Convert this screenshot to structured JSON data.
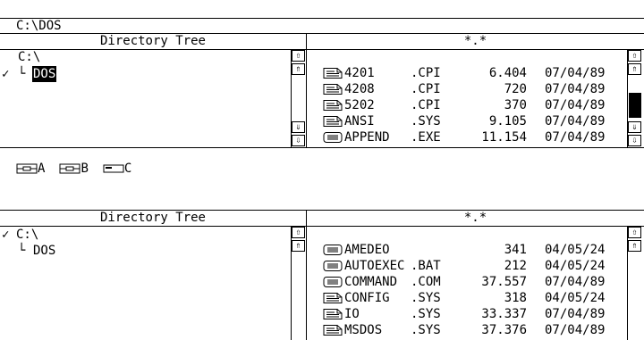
{
  "path": "C:\\DOS",
  "top": {
    "tree_header": "Directory Tree",
    "files_header": "*.*",
    "tree": {
      "root": "C:\\",
      "child_prefix": "└",
      "child": "DOS",
      "check": "✓"
    },
    "files": [
      {
        "icon": "document-icon",
        "name": "4201",
        "ext": ".CPI",
        "size": "6.404",
        "date": "07/04/89"
      },
      {
        "icon": "document-icon",
        "name": "4208",
        "ext": ".CPI",
        "size": "720",
        "date": "07/04/89"
      },
      {
        "icon": "document-icon",
        "name": "5202",
        "ext": ".CPI",
        "size": "370",
        "date": "07/04/89"
      },
      {
        "icon": "document-icon",
        "name": "ANSI",
        "ext": ".SYS",
        "size": "9.105",
        "date": "07/04/89"
      },
      {
        "icon": "program-icon",
        "name": "APPEND",
        "ext": ".EXE",
        "size": "11.154",
        "date": "07/04/89"
      }
    ]
  },
  "drives": [
    "A",
    "B",
    "C"
  ],
  "bottom": {
    "tree_header": "Directory Tree",
    "files_header": "*.*",
    "tree": {
      "root": "C:\\",
      "child_prefix": "└",
      "child": "DOS",
      "check": "✓"
    },
    "files": [
      {
        "icon": "program-icon",
        "name": "AMEDEO",
        "ext": "",
        "size": "341",
        "date": "04/05/24"
      },
      {
        "icon": "program-icon",
        "name": "AUTOEXEC",
        "ext": ".BAT",
        "size": "212",
        "date": "04/05/24"
      },
      {
        "icon": "program-icon",
        "name": "COMMAND",
        "ext": ".COM",
        "size": "37.557",
        "date": "07/04/89"
      },
      {
        "icon": "document-icon",
        "name": "CONFIG",
        "ext": ".SYS",
        "size": "318",
        "date": "04/05/24"
      },
      {
        "icon": "document-icon",
        "name": "IO",
        "ext": ".SYS",
        "size": "33.337",
        "date": "07/04/89"
      },
      {
        "icon": "document-icon",
        "name": "MSDOS",
        "ext": ".SYS",
        "size": "37.376",
        "date": "07/04/89"
      }
    ]
  }
}
